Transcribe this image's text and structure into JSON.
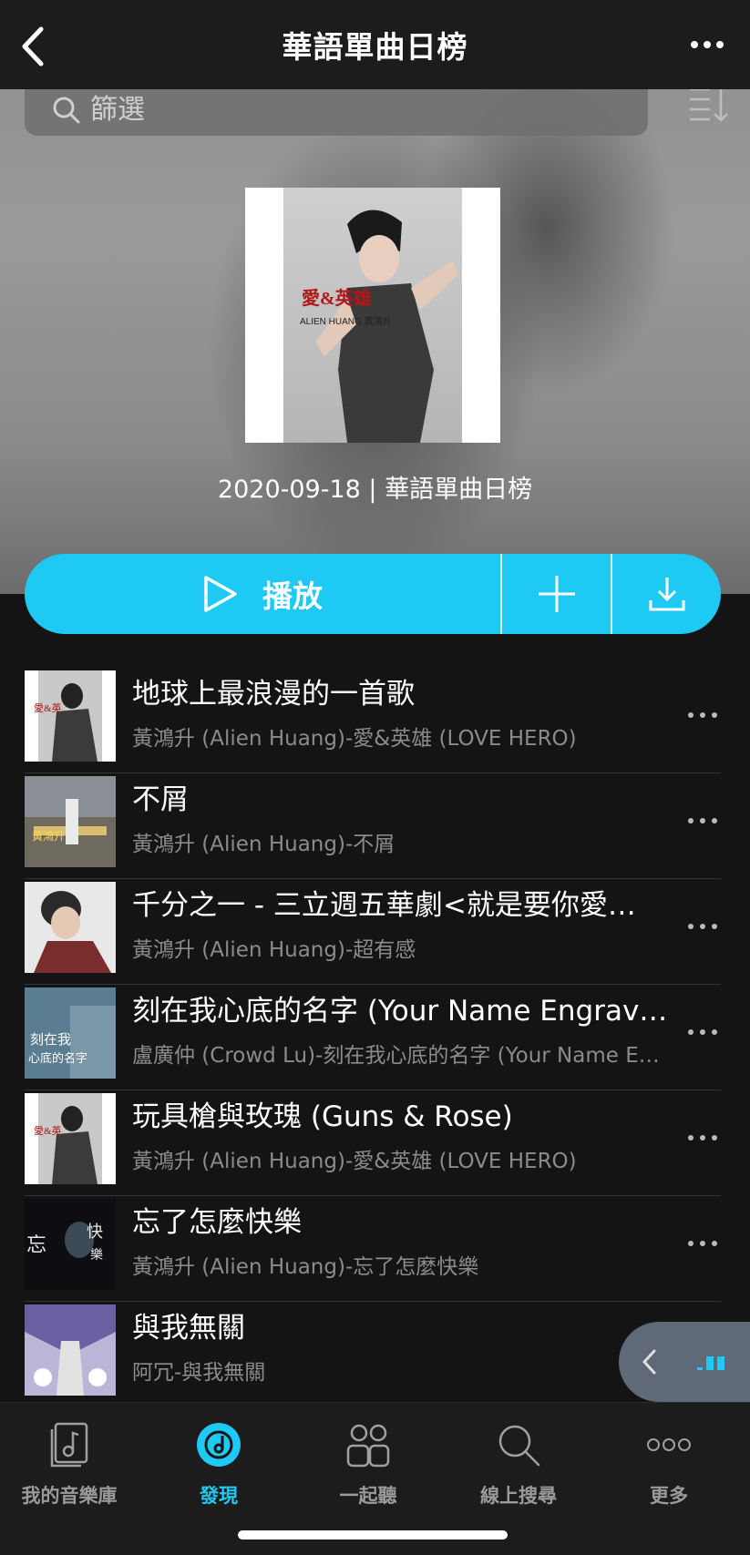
{
  "header": {
    "title": "華語單曲日榜",
    "back_icon": "chevron-left-icon",
    "more_icon": "ellipsis-icon"
  },
  "search": {
    "placeholder": "篩選",
    "sort_icon": "sort-icon"
  },
  "playlist": {
    "subtitle": "2020-09-18 | 華語單曲日榜"
  },
  "actions": {
    "play_label": "播放",
    "accent_color": "#1ec9f3"
  },
  "songs": [
    {
      "title": "地球上最浪漫的一首歌",
      "subtitle": "黃鴻升 (Alien Huang)-愛&英雄 (LOVE HERO)"
    },
    {
      "title": "不屑",
      "subtitle": "黃鴻升 (Alien Huang)-不屑"
    },
    {
      "title": "千分之一 - 三立週五華劇<就是要你愛…",
      "subtitle": "黃鴻升 (Alien Huang)-超有感"
    },
    {
      "title": "刻在我心底的名字 (Your Name Engrave…",
      "subtitle": "盧廣仲 (Crowd Lu)-刻在我心底的名字 (Your Name E…"
    },
    {
      "title": "玩具槍與玫瑰 (Guns & Rose)",
      "subtitle": "黃鴻升 (Alien Huang)-愛&英雄 (LOVE HERO)"
    },
    {
      "title": "忘了怎麼快樂",
      "subtitle": "黃鴻升 (Alien Huang)-忘了怎麼快樂"
    },
    {
      "title": "與我無關",
      "subtitle": "阿冗-與我無關"
    }
  ],
  "nav": {
    "items": [
      {
        "label": "我的音樂庫",
        "icon": "music-library-icon"
      },
      {
        "label": "發現",
        "icon": "discover-icon"
      },
      {
        "label": "一起聽",
        "icon": "listen-together-icon"
      },
      {
        "label": "線上搜尋",
        "icon": "search-icon"
      },
      {
        "label": "更多",
        "icon": "more-icon"
      }
    ]
  }
}
